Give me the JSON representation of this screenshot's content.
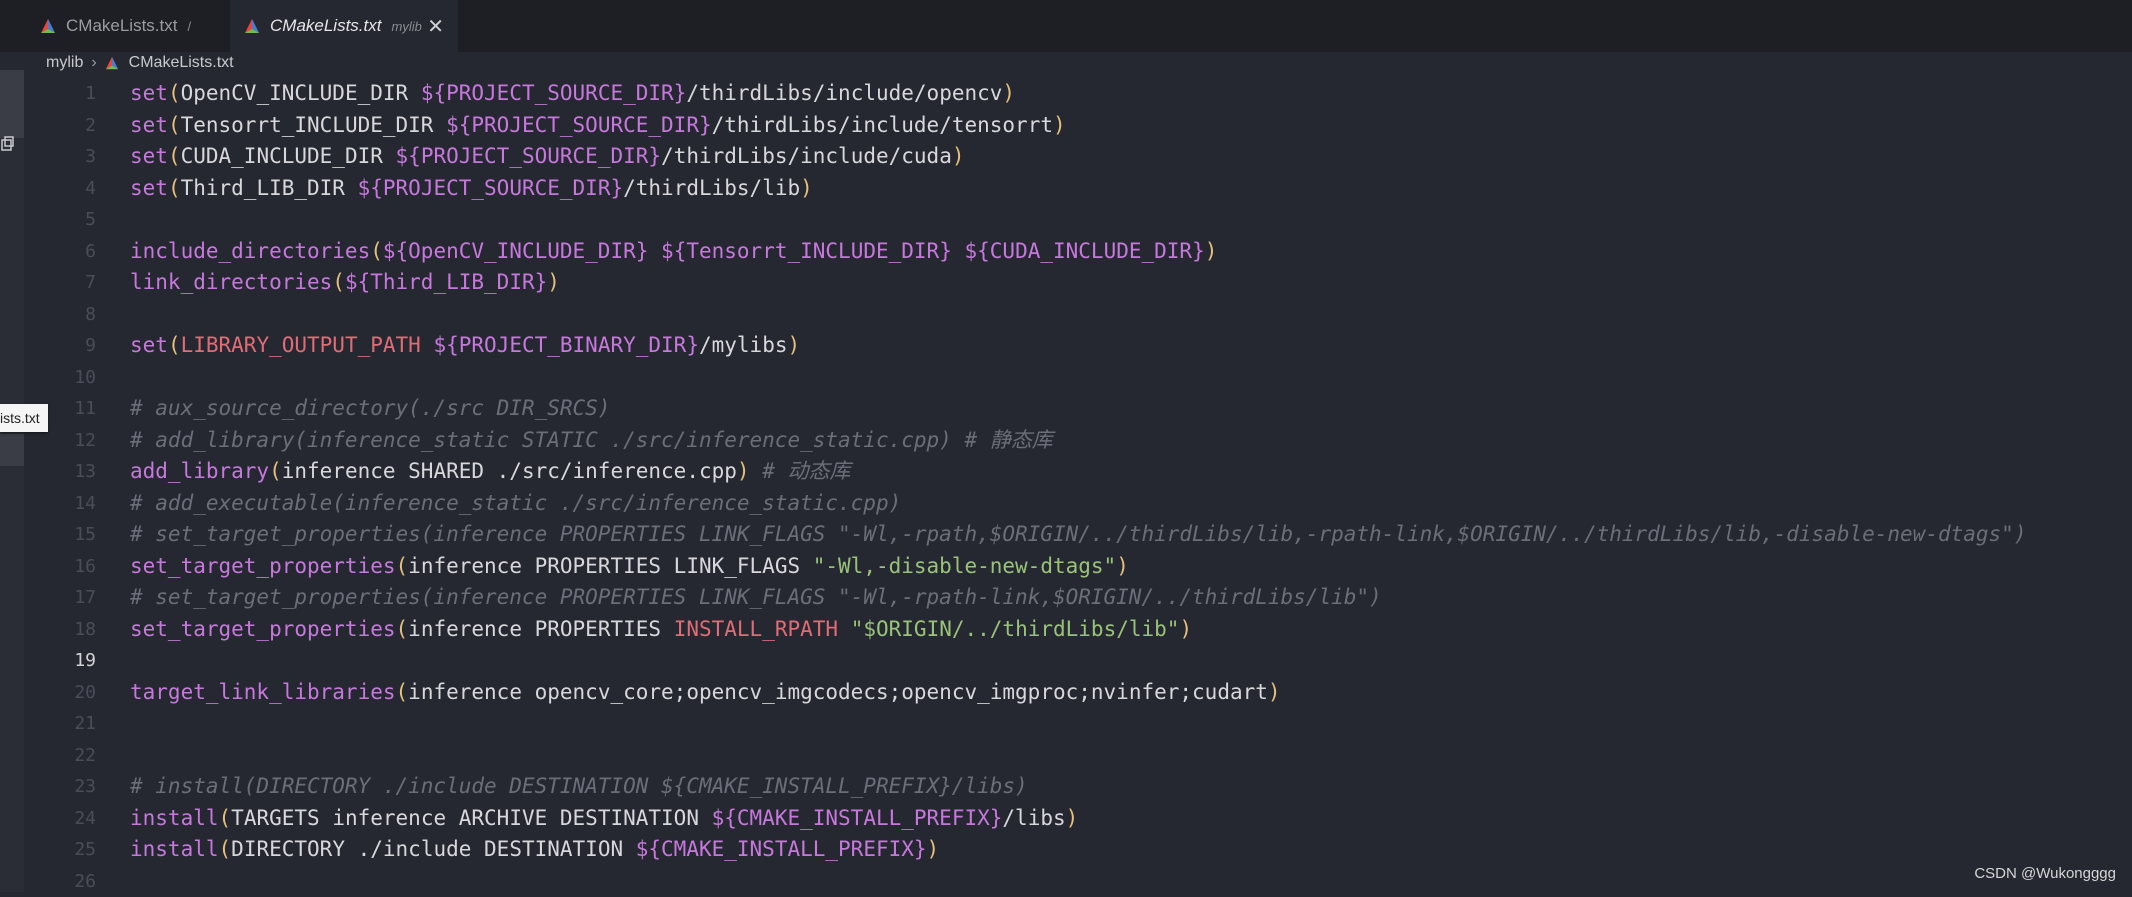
{
  "tabs": [
    {
      "name": "CMakeLists.txt",
      "sub": "/"
    },
    {
      "name": "CMakeLists.txt",
      "sub": "mylib"
    }
  ],
  "breadcrumb": {
    "folder": "mylib",
    "file": "CMakeLists.txt"
  },
  "tooltip": "ists.txt",
  "watermark": "CSDN @Wukongggg",
  "colors": {
    "cmake_icon": "#e8453c",
    "keyword": "#c678dd",
    "paren": "#e5c07b",
    "comment": "#6b6e78",
    "string": "#98c379",
    "property": "#e06c75"
  },
  "active_line": 19,
  "lines": [
    {
      "n": "1",
      "tokens": [
        [
          "kw",
          "set"
        ],
        [
          "pn",
          "("
        ],
        [
          "tx",
          "OpenCV_INCLUDE_DIR "
        ],
        [
          "va",
          "${PROJECT_SOURCE_DIR}"
        ],
        [
          "tx",
          "/thirdLibs/include/opencv"
        ],
        [
          "pn",
          ")"
        ]
      ]
    },
    {
      "n": "2",
      "tokens": [
        [
          "kw",
          "set"
        ],
        [
          "pn",
          "("
        ],
        [
          "tx",
          "Tensorrt_INCLUDE_DIR "
        ],
        [
          "va",
          "${PROJECT_SOURCE_DIR}"
        ],
        [
          "tx",
          "/thirdLibs/include/tensorrt"
        ],
        [
          "pn",
          ")"
        ]
      ]
    },
    {
      "n": "3",
      "tokens": [
        [
          "kw",
          "set"
        ],
        [
          "pn",
          "("
        ],
        [
          "tx",
          "CUDA_INCLUDE_DIR "
        ],
        [
          "va",
          "${PROJECT_SOURCE_DIR}"
        ],
        [
          "tx",
          "/thirdLibs/include/cuda"
        ],
        [
          "pn",
          ")"
        ]
      ]
    },
    {
      "n": "4",
      "tokens": [
        [
          "kw",
          "set"
        ],
        [
          "pn",
          "("
        ],
        [
          "tx",
          "Third_LIB_DIR "
        ],
        [
          "va",
          "${PROJECT_SOURCE_DIR}"
        ],
        [
          "tx",
          "/thirdLibs/lib"
        ],
        [
          "pn",
          ")"
        ]
      ]
    },
    {
      "n": "5",
      "tokens": []
    },
    {
      "n": "6",
      "tokens": [
        [
          "kw",
          "include_directories"
        ],
        [
          "pn",
          "("
        ],
        [
          "va",
          "${OpenCV_INCLUDE_DIR}"
        ],
        [
          "tx",
          " "
        ],
        [
          "va",
          "${Tensorrt_INCLUDE_DIR}"
        ],
        [
          "tx",
          " "
        ],
        [
          "va",
          "${CUDA_INCLUDE_DIR}"
        ],
        [
          "pn",
          ")"
        ]
      ]
    },
    {
      "n": "7",
      "tokens": [
        [
          "kw",
          "link_directories"
        ],
        [
          "pn",
          "("
        ],
        [
          "va",
          "${Third_LIB_DIR}"
        ],
        [
          "pn",
          ")"
        ]
      ]
    },
    {
      "n": "8",
      "tokens": []
    },
    {
      "n": "9",
      "tokens": [
        [
          "kw",
          "set"
        ],
        [
          "pn",
          "("
        ],
        [
          "rd",
          "LIBRARY_OUTPUT_PATH"
        ],
        [
          "tx",
          " "
        ],
        [
          "va",
          "${PROJECT_BINARY_DIR}"
        ],
        [
          "tx",
          "/mylibs"
        ],
        [
          "pn",
          ")"
        ]
      ]
    },
    {
      "n": "10",
      "tokens": []
    },
    {
      "n": "11",
      "tokens": [
        [
          "cm",
          "# aux_source_directory(./src DIR_SRCS)"
        ]
      ]
    },
    {
      "n": "12",
      "tokens": [
        [
          "cm",
          "# add_library(inference_static STATIC ./src/inference_static.cpp) # 静态库"
        ]
      ]
    },
    {
      "n": "13",
      "tokens": [
        [
          "kw",
          "add_library"
        ],
        [
          "pn",
          "("
        ],
        [
          "tx",
          "inference SHARED ./src/inference.cpp"
        ],
        [
          "pn",
          ")"
        ],
        [
          "cm",
          " # 动态库"
        ]
      ]
    },
    {
      "n": "14",
      "tokens": [
        [
          "cm",
          "# add_executable(inference_static ./src/inference_static.cpp)"
        ]
      ]
    },
    {
      "n": "15",
      "tokens": [
        [
          "cm",
          "# set_target_properties(inference PROPERTIES LINK_FLAGS \"-Wl,-rpath,$ORIGIN/../thirdLibs/lib,-rpath-link,$ORIGIN/../thirdLibs/lib,-disable-new-dtags\")"
        ]
      ]
    },
    {
      "n": "16",
      "tokens": [
        [
          "kw",
          "set_target_properties"
        ],
        [
          "pn",
          "("
        ],
        [
          "tx",
          "inference PROPERTIES LINK_FLAGS "
        ],
        [
          "st",
          "\"-Wl,-disable-new-dtags\""
        ],
        [
          "pn",
          ")"
        ]
      ]
    },
    {
      "n": "17",
      "tokens": [
        [
          "cm",
          "# set_target_properties(inference PROPERTIES LINK_FLAGS \"-Wl,-rpath-link,$ORIGIN/../thirdLibs/lib\")"
        ]
      ]
    },
    {
      "n": "18",
      "tokens": [
        [
          "kw",
          "set_target_properties"
        ],
        [
          "pn",
          "("
        ],
        [
          "tx",
          "inference PROPERTIES "
        ],
        [
          "rd",
          "INSTALL_RPATH"
        ],
        [
          "tx",
          " "
        ],
        [
          "st",
          "\"$ORIGIN/../thirdLibs/lib\""
        ],
        [
          "pn",
          ")"
        ]
      ]
    },
    {
      "n": "19",
      "tokens": []
    },
    {
      "n": "20",
      "tokens": [
        [
          "kw",
          "target_link_libraries"
        ],
        [
          "pn",
          "("
        ],
        [
          "tx",
          "inference opencv_core;opencv_imgcodecs;opencv_imgproc;nvinfer;cudart"
        ],
        [
          "pn",
          ")"
        ]
      ]
    },
    {
      "n": "21",
      "tokens": []
    },
    {
      "n": "22",
      "tokens": []
    },
    {
      "n": "23",
      "tokens": [
        [
          "cm",
          "# install(DIRECTORY ./include DESTINATION ${CMAKE_INSTALL_PREFIX}/libs)"
        ]
      ]
    },
    {
      "n": "24",
      "tokens": [
        [
          "kw",
          "install"
        ],
        [
          "pn",
          "("
        ],
        [
          "tx",
          "TARGETS inference ARCHIVE DESTINATION "
        ],
        [
          "va",
          "${CMAKE_INSTALL_PREFIX}"
        ],
        [
          "tx",
          "/libs"
        ],
        [
          "pn",
          ")"
        ]
      ]
    },
    {
      "n": "25",
      "tokens": [
        [
          "kw",
          "install"
        ],
        [
          "pn",
          "("
        ],
        [
          "tx",
          "DIRECTORY ./include DESTINATION "
        ],
        [
          "va",
          "${CMAKE_INSTALL_PREFIX}"
        ],
        [
          "pn",
          ")"
        ]
      ]
    },
    {
      "n": "26",
      "tokens": []
    }
  ]
}
